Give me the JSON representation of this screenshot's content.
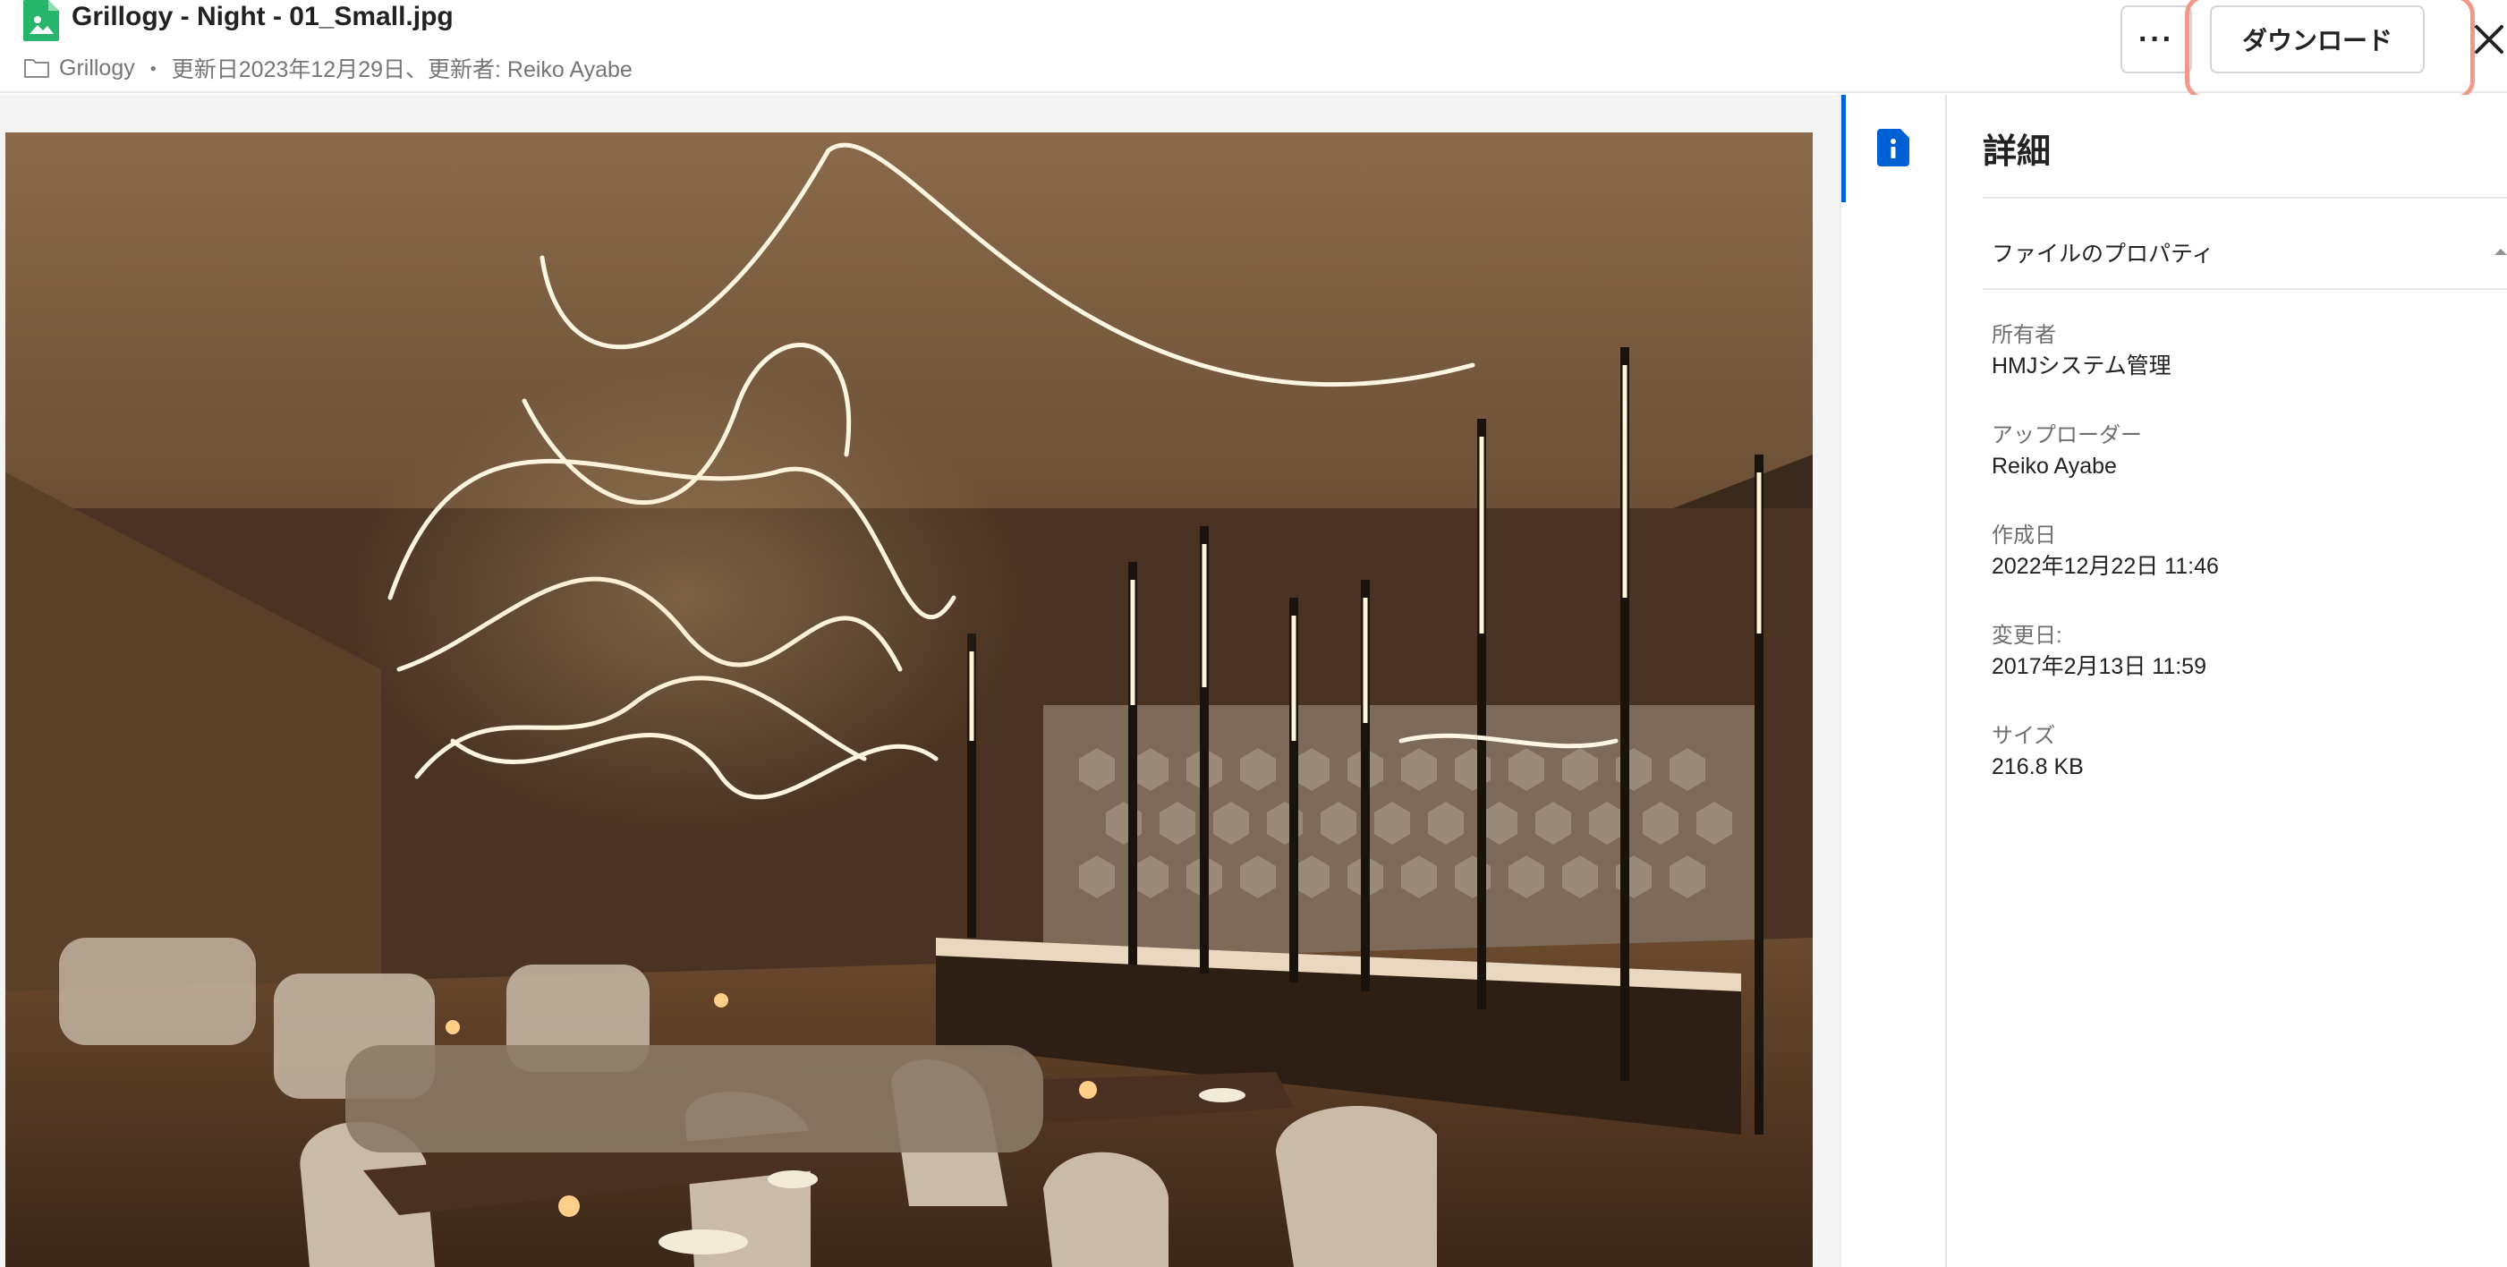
{
  "header": {
    "file_name": "Grillogy - Night - 01_Small.jpg",
    "folder": "Grillogy",
    "separator": "・",
    "modified_text": "更新日2023年12月29日、更新者: Reiko Ayabe",
    "more_label": "···",
    "download_label": "ダウンロード"
  },
  "sidebar": {
    "title": "詳細",
    "section_label": "ファイルのプロパティ",
    "properties": [
      {
        "label": "所有者",
        "value": "HMJシステム管理"
      },
      {
        "label": "アップローダー",
        "value": "Reiko Ayabe"
      },
      {
        "label": "作成日",
        "value": "2022年12月22日 11:46"
      },
      {
        "label": "変更日:",
        "value": "2017年2月13日 11:59"
      },
      {
        "label": "サイズ",
        "value": "216.8 KB"
      }
    ]
  },
  "icons": {
    "file": "image-file-icon",
    "folder": "folder-icon",
    "close": "close-icon",
    "info": "info-icon"
  },
  "colors": {
    "accent": "#0061d5",
    "file_icon": "#26b56b",
    "highlight": "#f0998a"
  }
}
